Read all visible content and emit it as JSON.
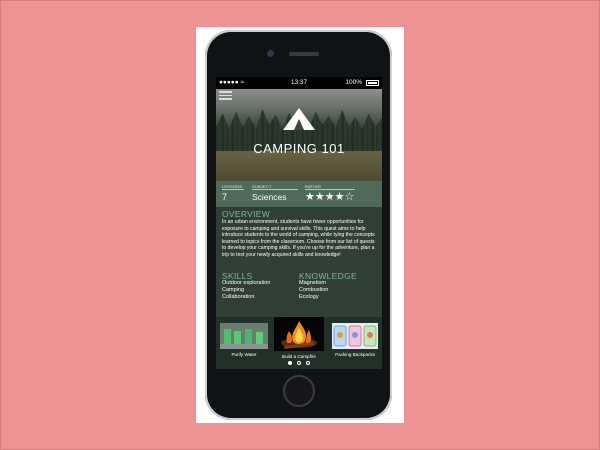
{
  "status": {
    "time": "13:37",
    "battery": "100%"
  },
  "course": {
    "title": "CAMPING 101",
    "lessons_label": "LESSONS",
    "lessons": "7",
    "subject_label": "SUBJECT",
    "subject": "Sciences",
    "rating_label": "RATING",
    "rating": 4,
    "rating_max": 5,
    "stars": "★★★★☆"
  },
  "overview": {
    "heading": "OVERVIEW",
    "text": "In an urban environment, students have fewer opportunities for exposure to camping and survival skills. This quest aims to help introduce students to the world of camping, while tying the concepts learned to topics from the classroom. Choose from our list of quests to develop your camping skills. If you're up for the adventure, plan a trip to test your newly acquired skills and knowledge!"
  },
  "skills": {
    "heading": "SKILLS",
    "items": [
      "Outdoor exploration",
      "Camping",
      "Collaboration"
    ]
  },
  "knowledge": {
    "heading": "KNOWLEDGE",
    "items": [
      "Magnetism",
      "Combustion",
      "Ecology"
    ]
  },
  "gallery": {
    "items": [
      {
        "caption": "Purify Water"
      },
      {
        "caption": "Build a Campfire"
      },
      {
        "caption": "Packing Backpacks"
      }
    ],
    "active_page": 1,
    "page_count": 3
  },
  "colors": {
    "background": "#ee9393",
    "accent_green": "#7fb79a",
    "stats_band": "#4e6b5a",
    "panel": "#2f3f36"
  }
}
